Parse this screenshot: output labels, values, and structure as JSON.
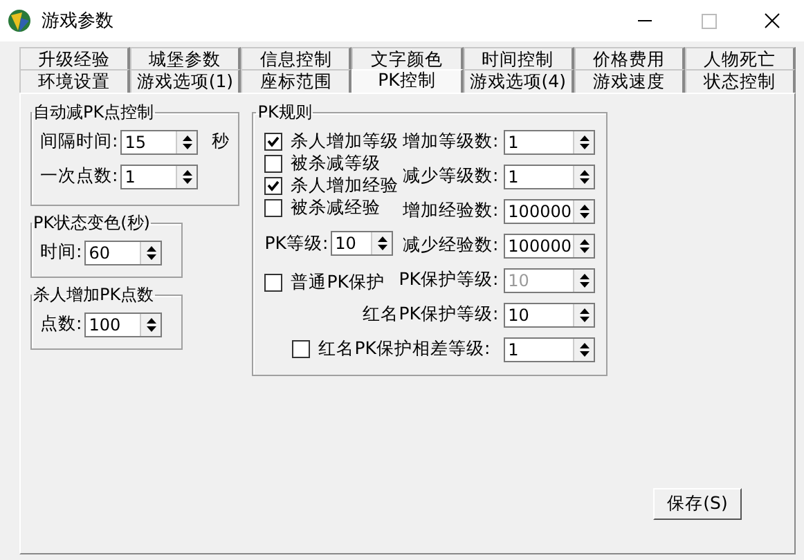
{
  "window": {
    "title": "游戏参数"
  },
  "tab_rows": [
    [
      {
        "label": "升级经验",
        "selected": false
      },
      {
        "label": "城堡参数",
        "selected": false
      },
      {
        "label": "信息控制",
        "selected": false
      },
      {
        "label": "文字颜色",
        "selected": false
      },
      {
        "label": "时间控制",
        "selected": false
      },
      {
        "label": "价格费用",
        "selected": false
      },
      {
        "label": "人物死亡",
        "selected": false
      }
    ],
    [
      {
        "label": "环境设置",
        "selected": false
      },
      {
        "label": "游戏选项(1)",
        "selected": false
      },
      {
        "label": "座标范围",
        "selected": false
      },
      {
        "label": "PK控制",
        "selected": true
      },
      {
        "label": "游戏选项(4)",
        "selected": false
      },
      {
        "label": "游戏速度",
        "selected": false
      },
      {
        "label": "状态控制",
        "selected": false
      }
    ]
  ],
  "left_groups": [
    {
      "title": "自动减PK点控制",
      "fields": [
        {
          "label": "间隔时间:",
          "value": "15",
          "suffix": "秒"
        },
        {
          "label": "一次点数:",
          "value": "1"
        }
      ]
    },
    {
      "title": "PK状态变色(秒)",
      "fields": [
        {
          "label": "时间:",
          "value": "60"
        }
      ]
    },
    {
      "title": "杀人增加PK点数",
      "fields": [
        {
          "label": "点数:",
          "value": "100"
        }
      ]
    }
  ],
  "pk_rules": {
    "title": "PK规则",
    "left": [
      {
        "kind": "checkbox",
        "label": "杀人增加等级",
        "checked": true
      },
      {
        "kind": "checkbox",
        "label": "被杀减等级",
        "checked": false
      },
      {
        "kind": "checkbox",
        "label": "杀人增加经验",
        "checked": true
      },
      {
        "kind": "checkbox",
        "label": "被杀减经验",
        "checked": false
      },
      {
        "kind": "spin",
        "label": "PK等级:",
        "value": "10"
      },
      {
        "kind": "checkbox",
        "label": "普通PK保护",
        "checked": false
      }
    ],
    "right": [
      {
        "label": "增加等级数:",
        "value": "1",
        "disabled": false
      },
      {
        "label": "减少等级数:",
        "value": "1",
        "disabled": false
      },
      {
        "label": "增加经验数:",
        "value": "100000",
        "disabled": false
      },
      {
        "label": "减少经验数:",
        "value": "100000",
        "disabled": false
      },
      {
        "label": "PK保护等级:",
        "value": "10",
        "disabled": true
      }
    ],
    "bottom": [
      {
        "kind": "field",
        "label": "红名PK保护等级:",
        "value": "10"
      },
      {
        "kind": "checkbox",
        "label": "红名PK保护相差等级:",
        "checked": false,
        "value": "1"
      }
    ]
  },
  "save_button": {
    "label": "保存(S)"
  }
}
